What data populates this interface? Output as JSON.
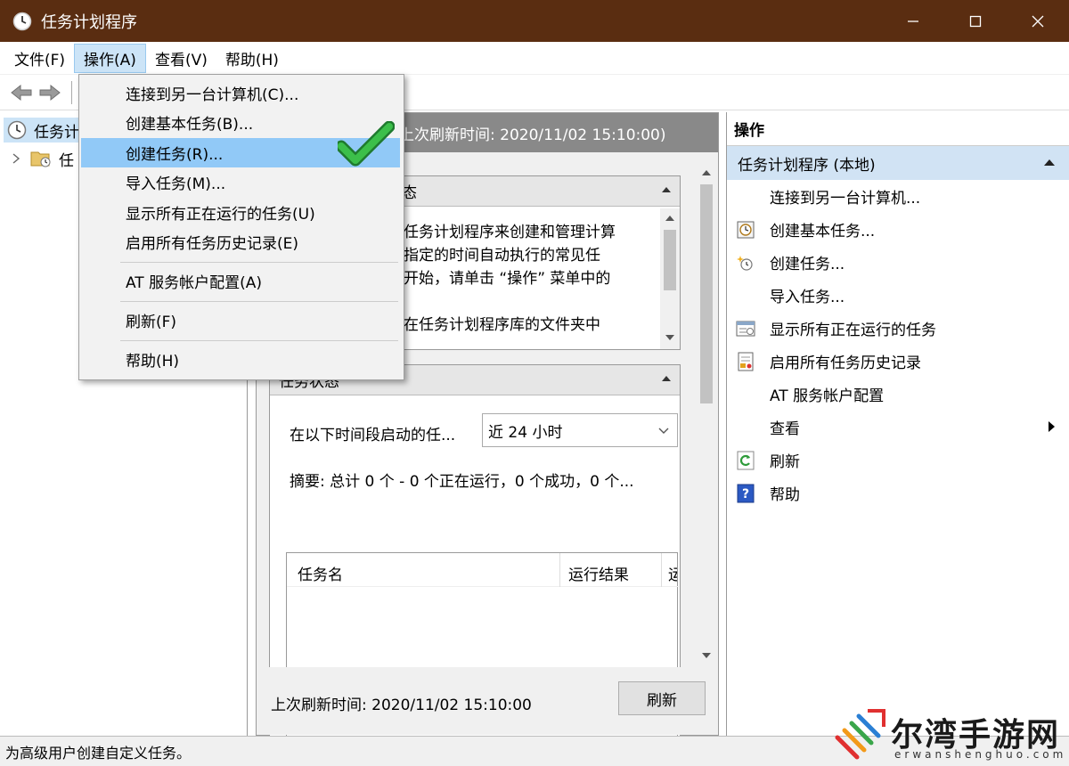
{
  "window": {
    "title": "任务计划程序"
  },
  "menubar": {
    "items": [
      "文件(F)",
      "操作(A)",
      "查看(V)",
      "帮助(H)"
    ],
    "active_index": 1
  },
  "tree": {
    "root_label": "任务计",
    "child_label": "任"
  },
  "dropdown": {
    "items": [
      "连接到另一台计算机(C)...",
      "创建基本任务(B)...",
      "创建任务(R)...",
      "导入任务(M)...",
      "显示所有正在运行的任务(U)",
      "启用所有任务历史记录(E)",
      "AT 服务帐户配置(A)",
      "刷新(F)",
      "帮助(H)"
    ],
    "highlighted_index": 2
  },
  "center": {
    "header_text": "上次刷新时间: 2020/11/02 15:10:00)",
    "overview_head": "态",
    "overview_lines": [
      "任务计划程序来创建和管理计算",
      "指定的时间自动执行的常见任",
      "开始，请单击 “操作” 菜单中的",
      "",
      "在任务计划程序库的文件夹中"
    ],
    "status_head": "任务状态",
    "period_label": "在以下时间段启动的任...",
    "period_value": "近 24 小时",
    "summary": "摘要: 总计 0 个 - 0 个正在运行，0 个成功，0 个...",
    "columns": [
      "任务名",
      "运行结果",
      "运"
    ],
    "last_refresh": "上次刷新时间: 2020/11/02 15:10:00",
    "refresh_button": "刷新"
  },
  "actions": {
    "title": "操作",
    "group": "任务计划程序 (本地)",
    "items": [
      {
        "label": "连接到另一台计算机...",
        "icon": "none"
      },
      {
        "label": "创建基本任务...",
        "icon": "basic-task-icon"
      },
      {
        "label": "创建任务...",
        "icon": "new-task-icon"
      },
      {
        "label": "导入任务...",
        "icon": "none"
      },
      {
        "label": "显示所有正在运行的任务",
        "icon": "running-tasks-icon"
      },
      {
        "label": "启用所有任务历史记录",
        "icon": "history-icon"
      },
      {
        "label": "AT 服务帐户配置",
        "icon": "none"
      },
      {
        "label": "查看",
        "icon": "none"
      },
      {
        "label": "刷新",
        "icon": "refresh-icon"
      },
      {
        "label": "帮助",
        "icon": "help-icon"
      }
    ]
  },
  "statusbar": {
    "text": "为高级用户创建自定义任务。"
  },
  "watermark": {
    "brand": "尔湾手游网",
    "url": "erwanshenghuo.com"
  },
  "colors": {
    "titlebar": "#5a2d11",
    "highlight": "#91c9f7",
    "check": "#2ea043"
  }
}
